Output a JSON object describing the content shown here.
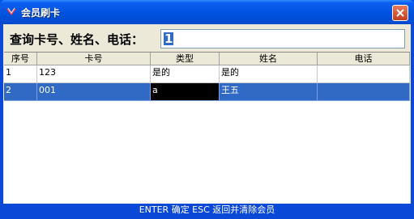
{
  "window": {
    "title": "会员刷卡",
    "icon": "card-logo-icon",
    "close_icon": "close-icon"
  },
  "search": {
    "label": "查询卡号、姓名、电话：",
    "value": "1"
  },
  "table": {
    "columns": [
      "序号",
      "卡号",
      "类型",
      "姓名",
      "电话"
    ],
    "rows": [
      {
        "no": "1",
        "card": "123",
        "type": "是的",
        "name": "是的",
        "phone": ""
      },
      {
        "no": "2",
        "card": "001",
        "type": "a",
        "name": "王五",
        "phone": ""
      }
    ]
  },
  "status": {
    "text": "ENTER 确定  ESC 返回并清除会员"
  },
  "colors": {
    "title_bar": "#0054e3",
    "selection": "#316ac5",
    "client_bg": "#ece9d8"
  }
}
